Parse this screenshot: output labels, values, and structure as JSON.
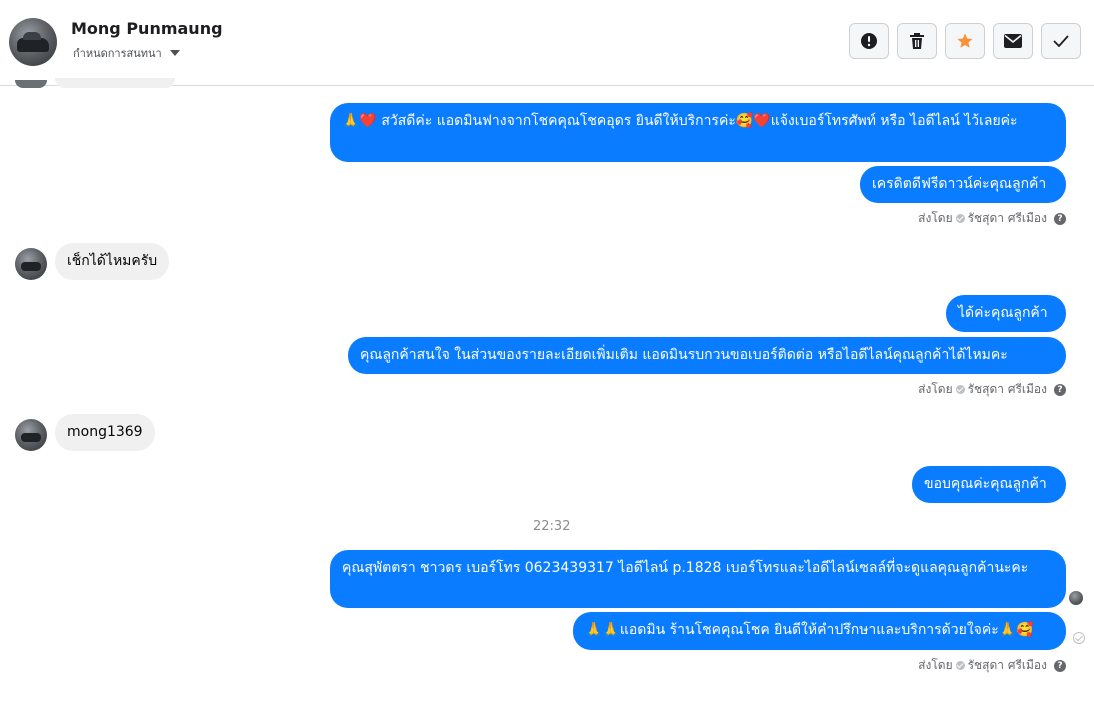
{
  "header": {
    "name": "Mong Punmaung",
    "subtitle": "กำหนดการสนทนา",
    "buttons": [
      {
        "icon": "alert-icon"
      },
      {
        "icon": "trash-icon"
      },
      {
        "icon": "star-icon",
        "color": "#f7923a"
      },
      {
        "icon": "mail-icon"
      },
      {
        "icon": "check-icon"
      }
    ]
  },
  "colors": {
    "outgoing_bubble": "#0a7cff",
    "incoming_bubble": "#f0f0f0",
    "meta_text": "#65676b"
  },
  "messages": {
    "m1": "🙏❤️ สวัสดีค่ะ แอดมินฟางจากโชคคุณโชคอุดร ยินดีให้บริการค่ะ🥰❤️แจ้งเบอร์โทรศัพท์ หรือ ไอดีไลน์  ไว้เลยค่ะ",
    "m2": "เครดิตดีฟรีดาวน์ค่ะคุณลูกค้า",
    "in1": "เช็กได้ไหมครับ",
    "m3": "ได้ค่ะคุณลูกค้า",
    "m4": "คุณลูกค้าสนใจ ในส่วนของรายละเอียดเพิ่มเติม แอดมินรบกวนขอเบอร์ติดต่อ หรือไอดีไลน์คุณลูกค้าได้ไหมคะ",
    "in2": "mong1369",
    "m5": "ขอบคุณค่ะคุณลูกค้า",
    "timestamp": "22:32",
    "m6": "คุณสุพัตตรา   ชาวดร      เบอร์โทร 0623439317  ไอดีไลน์ p.1828   เบอร์โทรและไอดีไลน์เซลล์ที่จะดูแลคุณลูกค้านะคะ",
    "m7": "🙏🙏แอดมิน ร้านโชคคุณโชค ยินดีให้คำปรึกษาและบริการด้วยใจค่ะ🙏🥰"
  },
  "sent_by": {
    "prefix": "ส่งโดย",
    "name": "รัชสุดา ศรีเมือง"
  }
}
